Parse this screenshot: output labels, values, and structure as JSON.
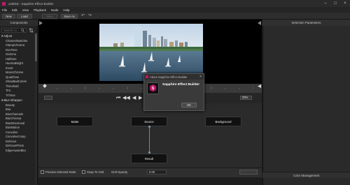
{
  "window": {
    "title": "untitled - Sapphire Effect Builder"
  },
  "menu": [
    "File",
    "Edit",
    "View",
    "Playback",
    "Node",
    "Help"
  ],
  "toolbar": {
    "new_label": "New",
    "load_label": "Load",
    "save_label": "Save",
    "saveas_label": "Save As"
  },
  "components": {
    "header": "Components",
    "search_placeholder": "Search co...",
    "groups": [
      {
        "name": "Adjust",
        "expanded": true,
        "items": [
          "ChannelSwitcher",
          "ClampChroma",
          "DuoTone",
          "Gamma",
          "Halftone",
          "HueSatBright",
          "Invert",
          "MonoChrome",
          "QuadTone",
          "ShowBadColors",
          "Threshold",
          "Tint",
          "TriTone"
        ]
      },
      {
        "name": "Blur+Sharpen",
        "expanded": true,
        "items": [
          "Beauty",
          "Blur",
          "BlurChannels",
          "BlurChroma",
          "BlurDirectional",
          "BlurMotion",
          "Convolve",
          "ConvolveComp",
          "Defocus",
          "DefocusPrism",
          "EdgeAwareBlur"
        ]
      }
    ]
  },
  "viewer": {
    "zoom": "39%"
  },
  "graph": {
    "nodes": {
      "matte": "Matte",
      "source": "Source",
      "background": "Background",
      "result": "Result"
    },
    "preview_selected_label": "Preview Selected Node",
    "snap_to_grid_label": "Snap To Grid",
    "grid_opacity_label": "Grid Opacity",
    "grid_opacity_value": "0.00"
  },
  "right_panel": {
    "selection_parameters": "Selection Parameters",
    "color_management": "Color Management"
  },
  "dialog": {
    "title": "About Sapphire Effect Builder",
    "app_name": "Sapphire Effect Builder",
    "ok_label": "OK"
  },
  "colors": {
    "accent": "#c2186b",
    "wire": "#3a9bdc",
    "port": "#2a6ad8"
  }
}
